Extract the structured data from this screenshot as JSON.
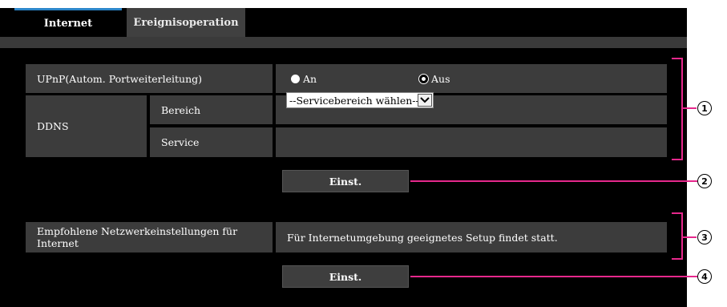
{
  "tabs": [
    {
      "label": "Internet",
      "active": true
    },
    {
      "label": "Ereignisoperation",
      "active": false
    }
  ],
  "upnp": {
    "label": "UPnP(Autom. Portweiterleitung)",
    "option_on": "An",
    "option_off": "Aus",
    "selected": "Aus"
  },
  "ddns": {
    "label": "DDNS",
    "bereich_label": "Bereich",
    "bereich_value": "--Servicebereich wählen--",
    "service_label": "Service",
    "service_value": ""
  },
  "buttons": {
    "set1": "Einst.",
    "set2": "Einst."
  },
  "recommended": {
    "label": "Empfohlene Netzwerkeinstellungen für Internet",
    "description": "Für Internetumgebung geeignetes Setup findet statt."
  },
  "callouts": [
    "1",
    "2",
    "3",
    "4"
  ],
  "colors": {
    "background": "#000000",
    "cell": "#3c3c3c",
    "tab_accent": "#2c86c9",
    "annotation": "#e6288c"
  }
}
